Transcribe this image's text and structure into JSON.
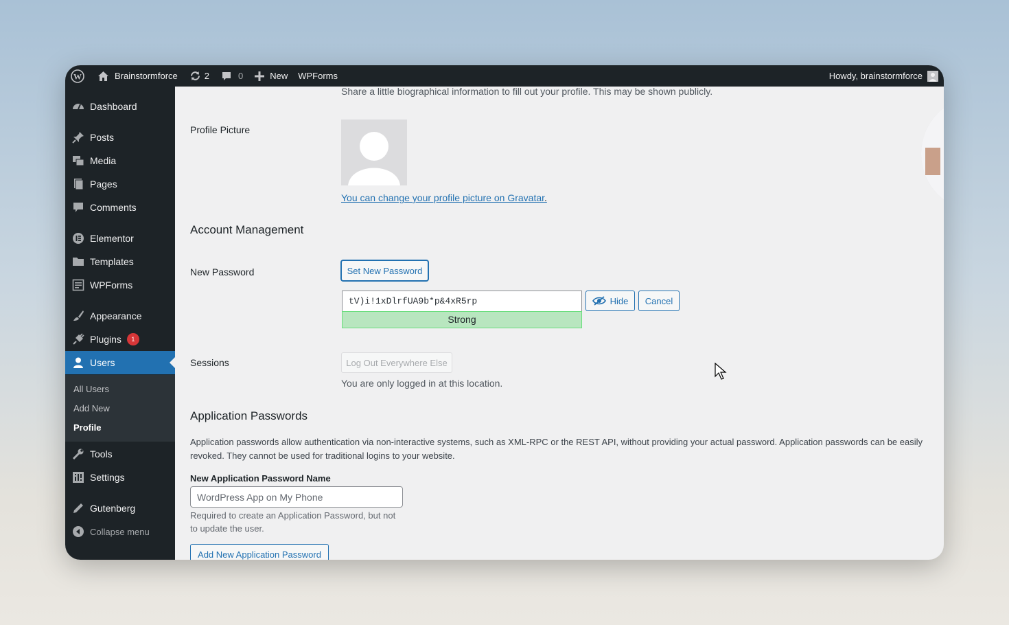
{
  "adminbar": {
    "site_name": "Brainstormforce",
    "updates_count": "2",
    "comments_count": "0",
    "new_label": "New",
    "wpforms_label": "WPForms",
    "howdy": "Howdy, brainstormforce"
  },
  "sidebar": {
    "items": [
      {
        "label": "Dashboard",
        "icon": "dashboard-icon"
      },
      {
        "label": "Posts",
        "icon": "pin-icon"
      },
      {
        "label": "Media",
        "icon": "media-icon"
      },
      {
        "label": "Pages",
        "icon": "pages-icon"
      },
      {
        "label": "Comments",
        "icon": "comment-icon"
      },
      {
        "label": "Elementor",
        "icon": "elementor-icon"
      },
      {
        "label": "Templates",
        "icon": "folder-icon"
      },
      {
        "label": "WPForms",
        "icon": "form-icon"
      },
      {
        "label": "Appearance",
        "icon": "brush-icon"
      },
      {
        "label": "Plugins",
        "icon": "plug-icon",
        "badge": "1"
      },
      {
        "label": "Users",
        "icon": "user-icon",
        "active": true
      },
      {
        "label": "Tools",
        "icon": "wrench-icon"
      },
      {
        "label": "Settings",
        "icon": "settings-icon"
      },
      {
        "label": "Gutenberg",
        "icon": "pencil-icon"
      }
    ],
    "submenu": [
      "All Users",
      "Add New",
      "Profile"
    ],
    "collapse_label": "Collapse menu"
  },
  "profile": {
    "bio_description": "Share a little biographical information to fill out your profile. This may be shown publicly.",
    "picture_label": "Profile Picture",
    "gravatar_link": "You can change your profile picture on Gravatar",
    "gravatar_period": "."
  },
  "account": {
    "heading": "Account Management",
    "new_password_label": "New Password",
    "set_new_password_button": "Set New Password",
    "password_value": "tV)i!1xDlrfUA9b*p&4xR5rp",
    "strength_text": "Strong",
    "hide_button": "Hide",
    "cancel_button": "Cancel",
    "sessions_label": "Sessions",
    "logout_button": "Log Out Everywhere Else",
    "sessions_desc": "You are only logged in at this location."
  },
  "app_passwords": {
    "heading": "Application Passwords",
    "description": "Application passwords allow authentication via non-interactive systems, such as XML-RPC or the REST API, without providing your actual password. Application passwords can be easily revoked. They cannot be used for traditional logins to your website.",
    "name_label": "New Application Password Name",
    "name_placeholder": "WordPress App on My Phone",
    "help_text": "Required to create an Application Password, but not to update the user.",
    "add_button": "Add New Application Password"
  },
  "colors": {
    "admin_dark": "#1d2327",
    "accent_blue": "#2271b1",
    "strength_green": "#b8e6bf",
    "badge_red": "#d63638"
  }
}
